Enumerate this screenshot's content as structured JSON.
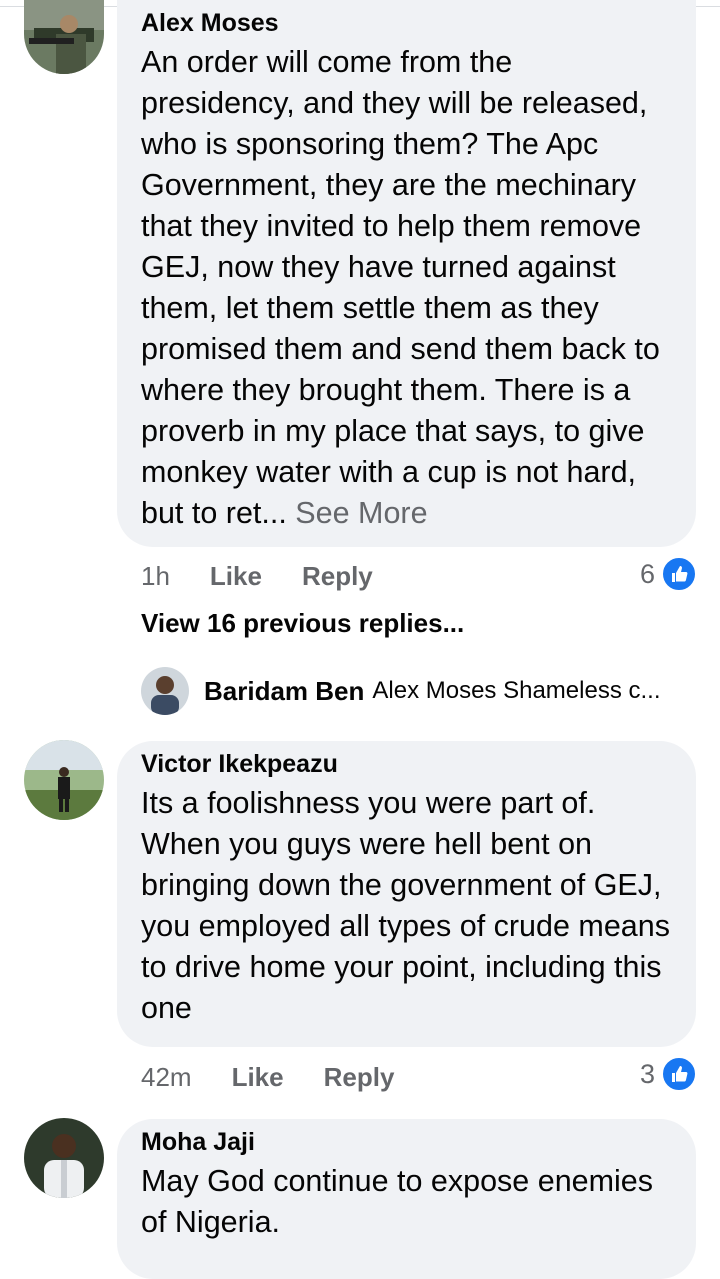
{
  "comments": [
    {
      "author": "Alex Moses",
      "text": "An order will come from the presidency, and they will be released, who is sponsoring them? The Apc Government,  they are the mechinary that they invited to help them remove GEJ, now they have turned against them, let them settle them as they promised them and send them back to where they brought them. There is a proverb in my place that says, to give monkey water with a cup is not hard, but to ret...",
      "see_more": "See More",
      "time": "1h",
      "like_label": "Like",
      "reply_label": "Reply",
      "reaction_count": "6"
    },
    {
      "author": "Victor Ikekpeazu",
      "text": "Its a foolishness you were part of. When you guys were hell bent on bringing down the government of GEJ, you employed all types of crude means to drive home your point, including this one",
      "time": "42m",
      "like_label": "Like",
      "reply_label": "Reply",
      "reaction_count": "3"
    },
    {
      "author": "Moha Jaji",
      "text": "May God continue to expose enemies of Nigeria."
    }
  ],
  "replies": {
    "view_previous": "View 16 previous replies...",
    "latest_author": "Baridam Ben",
    "latest_snippet": "Alex Moses Shameless c..."
  },
  "colors": {
    "bubble": "#f0f2f5",
    "like_blue": "#1877f2",
    "meta_gray": "#65676b"
  },
  "icons": {
    "reaction": "like-thumb-icon"
  }
}
